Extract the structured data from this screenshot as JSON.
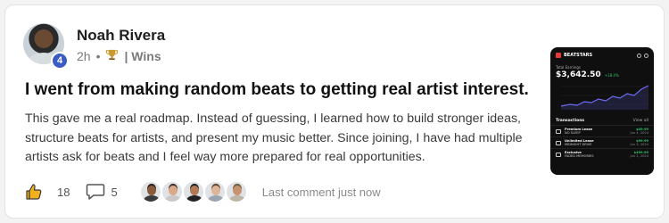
{
  "post": {
    "author": "Noah Rivera",
    "level": "4",
    "time": "2h",
    "separator": "•",
    "category": "| Wins",
    "title": "I went from making random beats to getting real artist interest.",
    "body": "This gave me a real roadmap. Instead of guessing, I learned how to build stronger ideas, structure beats for artists, and present my music better. Since joining, I have had multiple artists ask for beats and I feel way more prepared for real opportunities.",
    "likes": "18",
    "comments": "5",
    "last_comment": "Last comment just now"
  },
  "icons": {
    "trophy": "trophy-icon",
    "like": "thumbs-up-icon",
    "comment": "comment-bubble-icon"
  },
  "colors": {
    "level_badge": "#3b5cc4",
    "like_icon": "#f2b01e",
    "preview_bg": "#0f0f10",
    "preview_accent": "#e53935",
    "preview_positive": "#35c46b",
    "chart_line": "#6b6cf0"
  },
  "preview": {
    "brand": "BEATSTARS",
    "label": "Total Earnings",
    "amount": "$3,642.50",
    "change": "+18.4%",
    "transactions_title": "Transactions",
    "view_all": "View all",
    "transactions": [
      {
        "type": "Premium Lease",
        "title": "NO SLEEP",
        "amount": "$49.99",
        "date": "Jun 4, 2024"
      },
      {
        "type": "Unlimited Lease",
        "title": "MIDNIGHT DRIVE",
        "amount": "$99.99",
        "date": "Jun 3, 2024"
      },
      {
        "type": "Exclusive",
        "title": "FADED MEMORIES",
        "amount": "$499.99",
        "date": "Jun 2, 2024"
      }
    ]
  },
  "commenters": [
    {
      "skin": "#8a5a3c",
      "hair": "#2a1a12",
      "shirt": "#3a3a3a"
    },
    {
      "skin": "#d9a988",
      "hair": "#3b2a20",
      "shirt": "#c8c8c8"
    },
    {
      "skin": "#b07a55",
      "hair": "#1a1a1a",
      "shirt": "#222222"
    },
    {
      "skin": "#e0b496",
      "hair": "#5a4030",
      "shirt": "#9aa5b0"
    },
    {
      "skin": "#c69270",
      "hair": "#6b5a40",
      "shirt": "#bdb5a5"
    }
  ]
}
